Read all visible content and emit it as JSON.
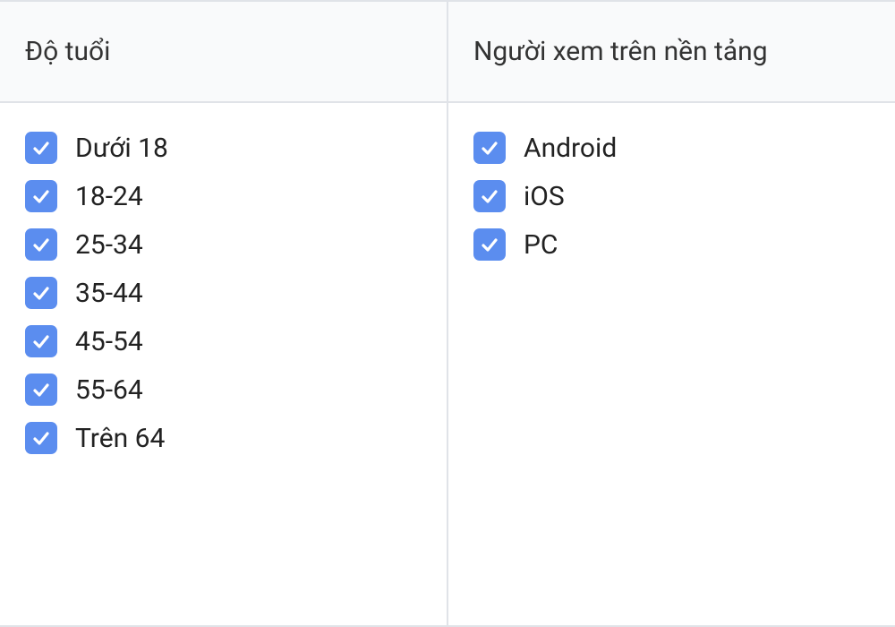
{
  "age": {
    "header": "Độ tuổi",
    "items": [
      {
        "label": "Dưới 18",
        "checked": true
      },
      {
        "label": "18-24",
        "checked": true
      },
      {
        "label": "25-34",
        "checked": true
      },
      {
        "label": "35-44",
        "checked": true
      },
      {
        "label": "45-54",
        "checked": true
      },
      {
        "label": "55-64",
        "checked": true
      },
      {
        "label": "Trên 64",
        "checked": true
      }
    ]
  },
  "platform": {
    "header": "Người xem trên nền tảng",
    "items": [
      {
        "label": "Android",
        "checked": true
      },
      {
        "label": "iOS",
        "checked": true
      },
      {
        "label": "PC",
        "checked": true
      }
    ]
  }
}
